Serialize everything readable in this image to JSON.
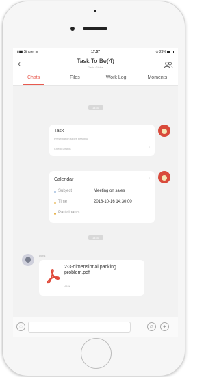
{
  "status_bar": {
    "carrier": "Singtel",
    "time": "17:07",
    "battery": "29%"
  },
  "header": {
    "title": "Task To Be(4)",
    "subtitle": "Gavin Global"
  },
  "tabs": [
    {
      "label": "Chats",
      "active": true
    },
    {
      "label": "Files",
      "active": false
    },
    {
      "label": "Work Log",
      "active": false
    },
    {
      "label": "Moments",
      "active": false
    }
  ],
  "messages": {
    "time_1": "14:30",
    "task_card": {
      "title": "Task",
      "subtitle": "Presentation slides beautiful",
      "link": "Check Details"
    },
    "calendar_card": {
      "title": "Calendar",
      "subject_label": "Subject",
      "subject_value": "Meeting on sales",
      "time_label": "Time",
      "time_value": "2018-10-16 14:30:00",
      "participants_label": "Participants"
    },
    "time_2": "14:30",
    "file_message": {
      "sender": "Doris",
      "file_name": "2-3-dimensional packing problem.pdf",
      "size": "488K"
    }
  },
  "icons": {
    "accent": "#e85a4f",
    "pdf_color": "#e04a3a"
  }
}
